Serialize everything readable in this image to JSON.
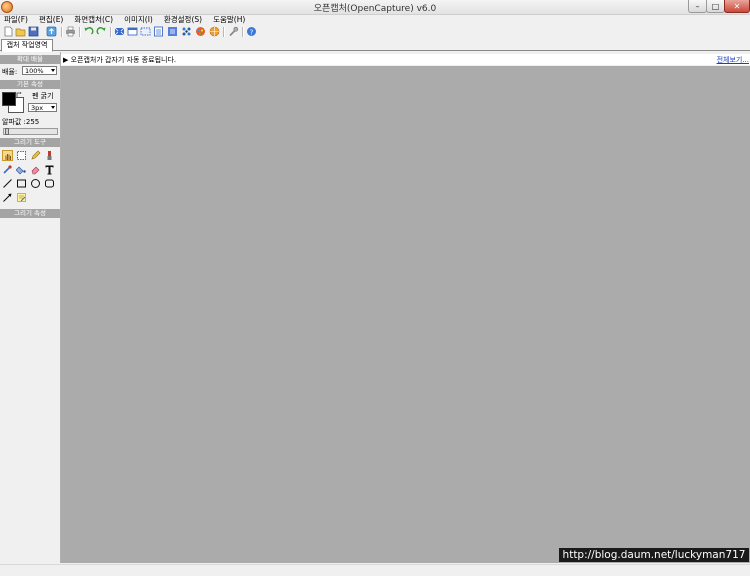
{
  "window": {
    "title": "오픈캡처(OpenCapture) v6.0",
    "minimize_glyph": "–",
    "maximize_glyph": "□",
    "close_glyph": "✕"
  },
  "menu": [
    {
      "label": "파일(F)"
    },
    {
      "label": "편집(E)"
    },
    {
      "label": "화면캡처(C)"
    },
    {
      "label": "이미지(I)"
    },
    {
      "label": "환경설정(S)"
    },
    {
      "label": "도움말(H)"
    }
  ],
  "toolbar": [
    {
      "icon": "new-file-icon"
    },
    {
      "icon": "open-folder-icon"
    },
    {
      "icon": "save-icon"
    },
    {
      "icon": "upload-icon"
    },
    {
      "icon": "print-icon"
    },
    {
      "icon": "undo-icon"
    },
    {
      "icon": "redo-icon"
    },
    {
      "icon": "fullscreen-capture-icon"
    },
    {
      "icon": "window-capture-icon"
    },
    {
      "icon": "region-capture-icon"
    },
    {
      "icon": "scroll-capture-icon"
    },
    {
      "icon": "freeform-capture-icon"
    },
    {
      "icon": "color-picker-icon"
    },
    {
      "icon": "palette-icon"
    },
    {
      "icon": "web-capture-icon"
    },
    {
      "icon": "settings-wrench-icon"
    },
    {
      "icon": "help-icon"
    }
  ],
  "tabs": {
    "capture_tab": "캡처 작업영역"
  },
  "status": {
    "message": "▶ 오픈캡처가 갑자기 자동 종료됩니다.",
    "fullview_link": "전체보기..."
  },
  "panel": {
    "zoom_header": "확대 배율",
    "zoom_label": "배율:",
    "zoom_value": "100%",
    "basic_header": "기본 속성",
    "pen_size_label": "펜 굵기",
    "pen_size_value": "3px",
    "alpha_label": "알파값 :255",
    "alpha_value": 255,
    "tools_header": "그리기 도구",
    "draw_props_header": "그리기 속성",
    "fg_color": "#000000",
    "bg_color": "#ffffff"
  },
  "tools": [
    {
      "icon": "hand-pan-icon"
    },
    {
      "icon": "selection-rect-icon"
    },
    {
      "icon": "pencil-icon"
    },
    {
      "icon": "brush-icon"
    },
    {
      "icon": "eyedropper-icon"
    },
    {
      "icon": "paint-bucket-icon"
    },
    {
      "icon": "eraser-icon"
    },
    {
      "icon": "text-tool-icon"
    },
    {
      "icon": "line-tool-icon"
    },
    {
      "icon": "rectangle-tool-icon"
    },
    {
      "icon": "ellipse-tool-icon"
    },
    {
      "icon": "rounded-rect-tool-icon"
    },
    {
      "icon": "arrow-tool-icon"
    },
    {
      "icon": "memo-tool-icon"
    }
  ],
  "watermark": "http://blog.daum.net/luckyman717"
}
